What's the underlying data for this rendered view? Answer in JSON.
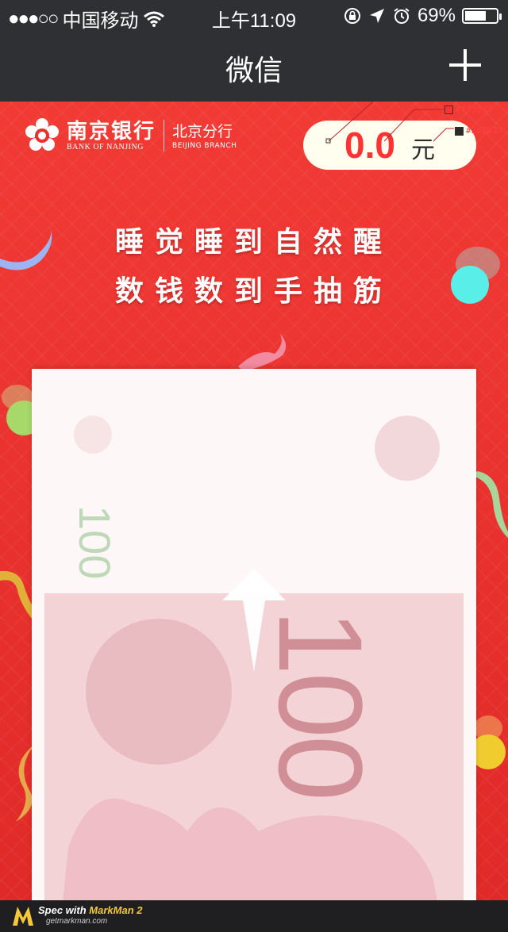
{
  "status_bar": {
    "signal_dots": "●●●○○",
    "carrier": "中国移动",
    "wifi_icon": "wifi-icon",
    "time": "上午11:09",
    "battery_percent": "69%",
    "battery_level": 0.69
  },
  "nav": {
    "title": "微信",
    "add_icon": "plus-icon"
  },
  "bank": {
    "name_cn": "南京银行",
    "name_en": "BANK OF NANJING",
    "branch_cn": "北京分行",
    "branch_en": "BEIJING BRANCH"
  },
  "balance": {
    "amount": "0.0",
    "unit": "元"
  },
  "slogan": {
    "line1": "睡觉睡到自然醒",
    "line2": "数钱数到手抽筋"
  },
  "annotations": {
    "color1": "#fffeef",
    "color2": "#ff3333",
    "color3": "#2b2b2b"
  },
  "bill": {
    "small_denomination": "100",
    "large_denomination": "100"
  },
  "footer": {
    "spec_with": "Spec with ",
    "brand": "MarkMan 2",
    "site": "getmarkman.com"
  },
  "colors": {
    "pill_bg": "#fffeef",
    "amount": "#ff3333",
    "unit": "#2b2b2b",
    "background": "#e8302c",
    "nav_bg": "#2f3033"
  }
}
